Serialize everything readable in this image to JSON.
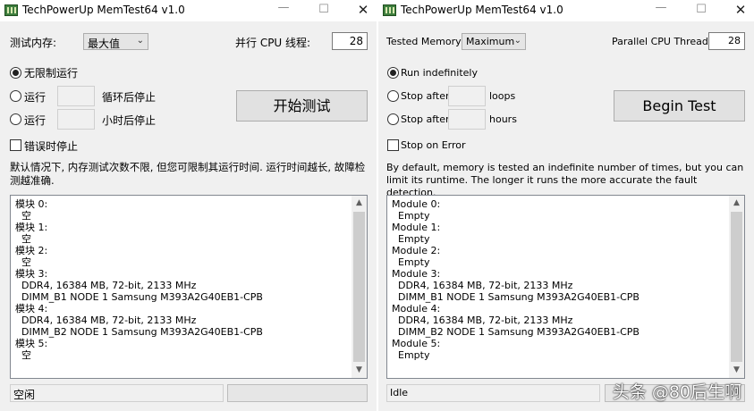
{
  "left": {
    "title": "TechPowerUp MemTest64 v1.0",
    "memory_label": "测试内存:",
    "memory_value": "最大值",
    "threads_label": "并行 CPU 线程:",
    "threads_value": "28",
    "run_indefinitely": "无限制运行",
    "run_after_loops_prefix": "运行",
    "run_after_loops_suffix": "循环后停止",
    "run_after_hours_prefix": "运行",
    "run_after_hours_suffix": "小时后停止",
    "stop_on_error": "错误时停止",
    "begin_test": "开始测试",
    "description": "默认情况下, 内存测试次数不限, 但您可限制其运行时间. 运行时间越长, 故障检测越准确.",
    "modules_text": "模块 0:\n  空\n模块 1:\n  空\n模块 2:\n  空\n模块 3:\n  DDR4, 16384 MB, 72-bit, 2133 MHz\n  DIMM_B1 NODE 1 Samsung M393A2G40EB1-CPB\n模块 4:\n  DDR4, 16384 MB, 72-bit, 2133 MHz\n  DIMM_B2 NODE 1 Samsung M393A2G40EB1-CPB\n模块 5:\n  空",
    "status": "空闲"
  },
  "right": {
    "title": "TechPowerUp MemTest64 v1.0",
    "memory_label": "Tested Memory:",
    "memory_value": "Maximum",
    "threads_label": "Parallel CPU Threads:",
    "threads_value": "28",
    "run_indefinitely": "Run indefinitely",
    "stop_after_loops_prefix": "Stop after",
    "stop_after_loops_suffix": "loops",
    "stop_after_hours_prefix": "Stop after",
    "stop_after_hours_suffix": "hours",
    "stop_on_error": "Stop on Error",
    "begin_test": "Begin Test",
    "description": "By default, memory is tested an indefinite number of times, but you can limit its runtime. The longer it runs the more accurate the fault detection.",
    "modules_text": "Module 0:\n  Empty\nModule 1:\n  Empty\nModule 2:\n  Empty\nModule 3:\n  DDR4, 16384 MB, 72-bit, 2133 MHz\n  DIMM_B1 NODE 1 Samsung M393A2G40EB1-CPB\nModule 4:\n  DDR4, 16384 MB, 72-bit, 2133 MHz\n  DIMM_B2 NODE 1 Samsung M393A2G40EB1-CPB\nModule 5:\n  Empty",
    "status": "Idle"
  },
  "watermark": "头条 @80后生啊",
  "icons": {
    "app": "memory-chip-icon",
    "minimize": "minimize-icon",
    "maximize": "maximize-icon",
    "close": "close-icon",
    "dropdown": "chevron-down-icon",
    "scroll_up": "scroll-up-icon",
    "scroll_down": "scroll-down-icon"
  }
}
